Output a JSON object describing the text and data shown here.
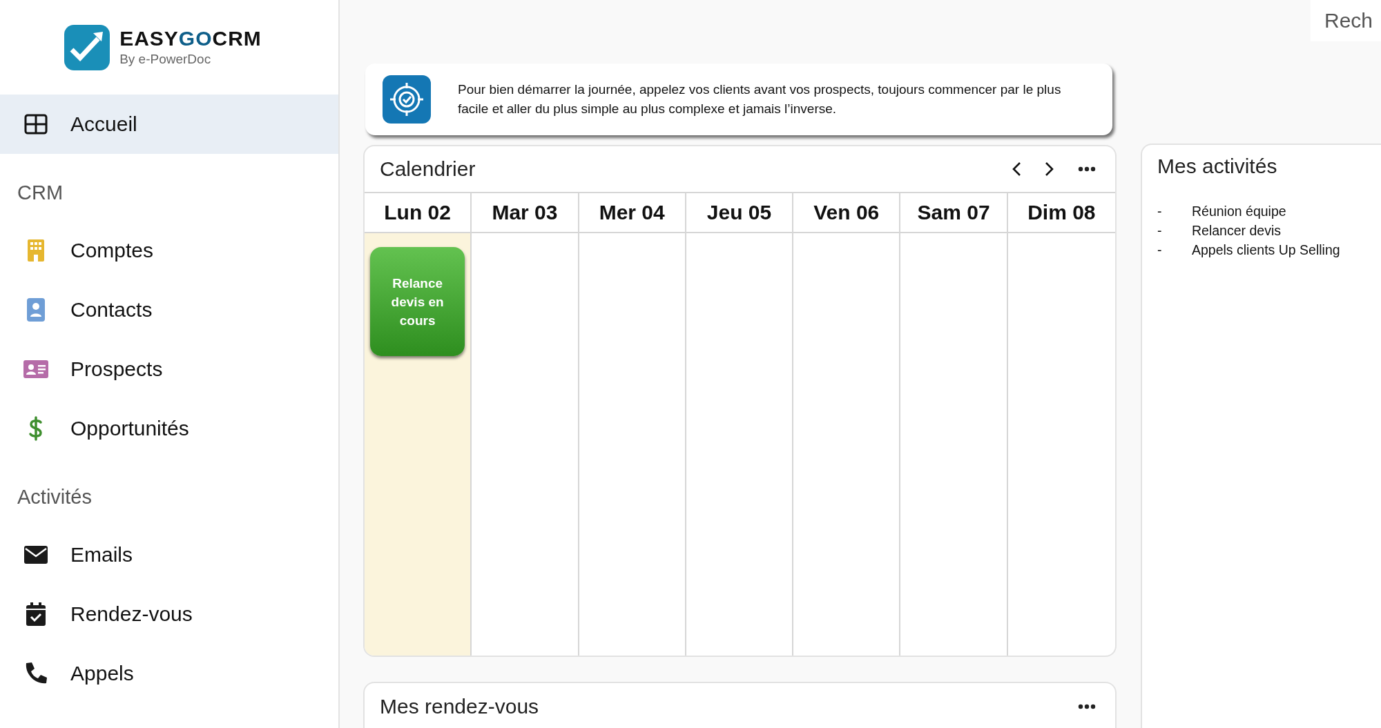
{
  "logo": {
    "brand_parts": [
      {
        "text": "EASY",
        "accent": false
      },
      {
        "text": "GO",
        "accent": true
      },
      {
        "text": "CRM",
        "accent": false
      }
    ],
    "tagline": "By e-PowerDoc"
  },
  "sidebar": {
    "sections": [
      {
        "items": [
          {
            "label": "Accueil",
            "selected": true
          }
        ]
      },
      {
        "heading": "CRM",
        "items": [
          {
            "label": "Comptes",
            "selected": false
          },
          {
            "label": "Contacts",
            "selected": false
          },
          {
            "label": "Prospects",
            "selected": false
          },
          {
            "label": "Opportunités",
            "selected": false
          }
        ]
      },
      {
        "heading": "Activités",
        "items": [
          {
            "label": "Emails",
            "selected": false
          },
          {
            "label": "Rendez-vous",
            "selected": false
          },
          {
            "label": "Appels",
            "selected": false
          }
        ]
      }
    ]
  },
  "search": {
    "placeholder": "Rech"
  },
  "tip": {
    "text": "Pour bien démarrer la journée, appelez vos clients avant vos prospects, toujours commencer par le plus facile et aller du plus simple au plus complexe et jamais l’inverse."
  },
  "calendar": {
    "title": "Calendrier",
    "days": [
      {
        "label": "Lun 02",
        "selected": true,
        "events": [
          {
            "title": "Relance devis en cours"
          }
        ]
      },
      {
        "label": "Mar 03",
        "selected": false
      },
      {
        "label": "Mer 04",
        "selected": false
      },
      {
        "label": "Jeu 05",
        "selected": false
      },
      {
        "label": "Ven 06",
        "selected": false
      },
      {
        "label": "Sam 07",
        "selected": false
      },
      {
        "label": "Dim 08",
        "selected": false
      }
    ]
  },
  "appointments": {
    "title": "Mes rendez-vous"
  },
  "activities": {
    "title": "Mes activités",
    "items": [
      {
        "marker": "-",
        "text": "Réunion équipe"
      },
      {
        "marker": "-",
        "text": "Relancer devis"
      },
      {
        "marker": "-",
        "text": "Appels clients Up Selling"
      }
    ]
  }
}
